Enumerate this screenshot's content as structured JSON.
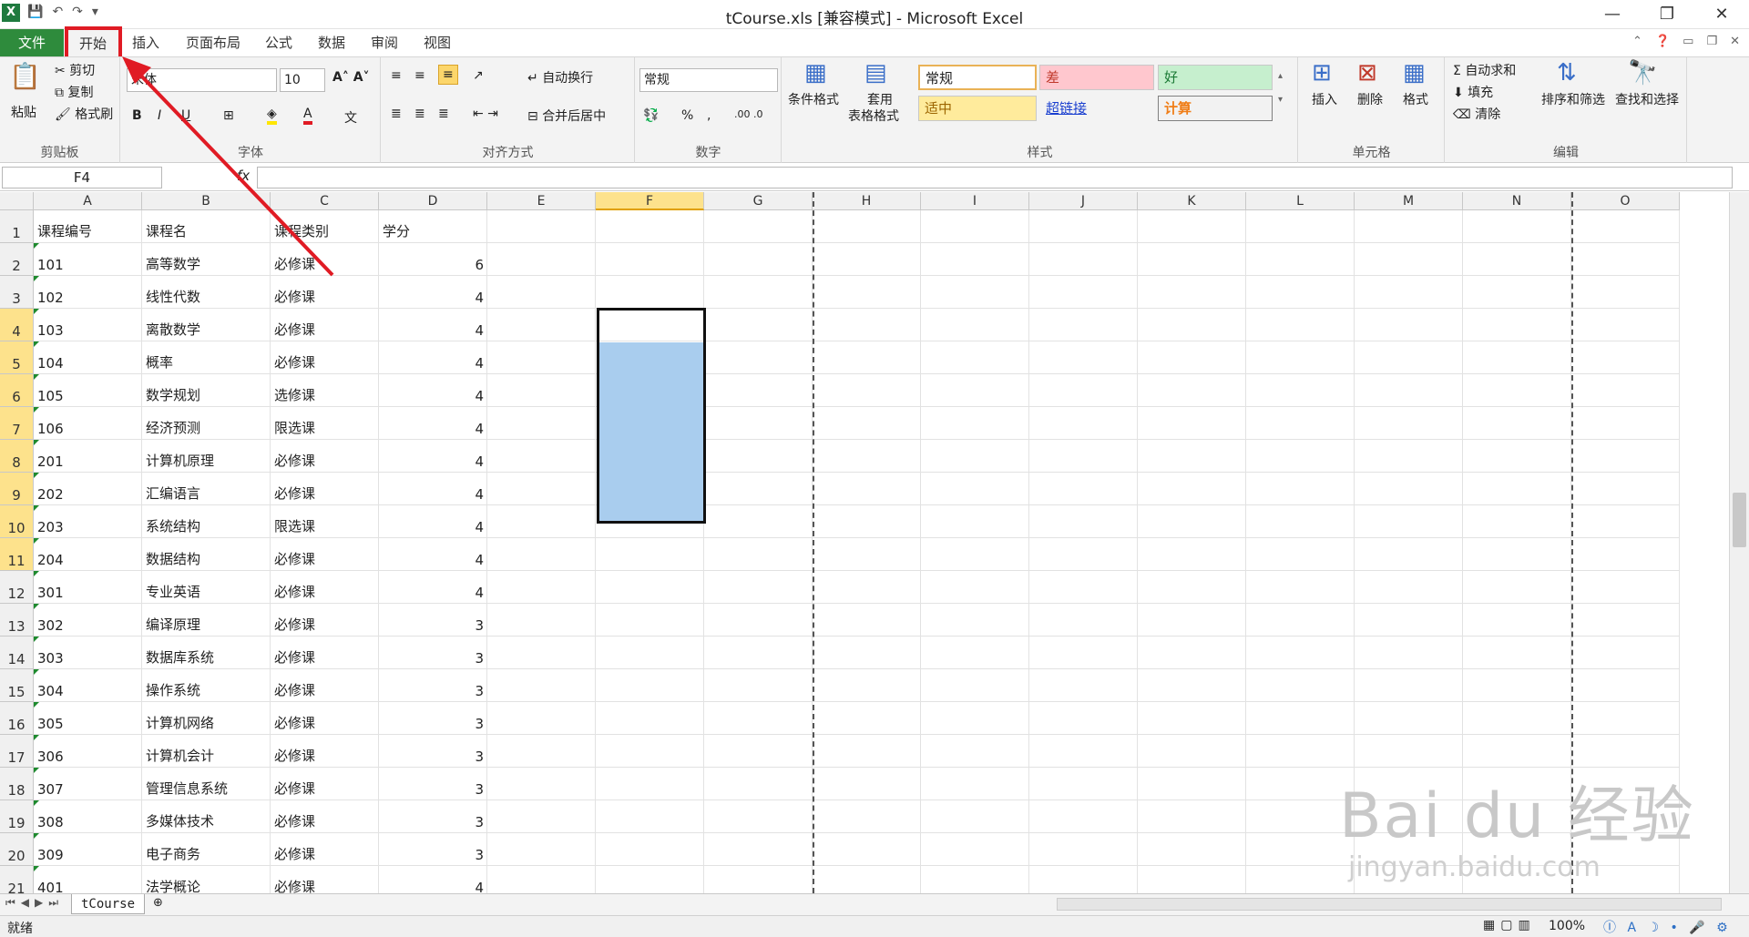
{
  "window": {
    "title": "tCourse.xls  [兼容模式] - Microsoft Excel",
    "min": "—",
    "restore": "❐",
    "close": "✕"
  },
  "tabs": [
    "文件",
    "开始",
    "插入",
    "页面布局",
    "公式",
    "数据",
    "审阅",
    "视图"
  ],
  "ribbon": {
    "clipboard": {
      "paste": "粘贴",
      "cut": "剪切",
      "copy": "复制",
      "format_painter": "格式刷",
      "label": "剪贴板"
    },
    "font": {
      "name": "宋体",
      "size": "10",
      "label": "字体"
    },
    "align": {
      "wrap": "自动换行",
      "merge": "合并后居中",
      "label": "对齐方式"
    },
    "number": {
      "format": "常规",
      "label": "数字"
    },
    "styles": {
      "cond": "条件格式",
      "table1": "套用",
      "table2": "表格格式",
      "normal": "常规",
      "bad": "差",
      "good": "好",
      "neutral": "适中",
      "hyperlink": "超链接",
      "calc": "计算",
      "label": "样式"
    },
    "cells": {
      "insert": "插入",
      "delete": "删除",
      "format": "格式",
      "label": "单元格"
    },
    "editing": {
      "autosum": "自动求和",
      "fill": "填充",
      "clear": "清除",
      "sort": "排序和筛选",
      "find": "查找和选择",
      "label": "编辑"
    }
  },
  "formula_bar": {
    "name_box": "F4",
    "fx": "fx",
    "value": ""
  },
  "columns": [
    "A",
    "B",
    "C",
    "D",
    "E",
    "F",
    "G",
    "H",
    "I",
    "J",
    "K",
    "L",
    "M",
    "N",
    "O"
  ],
  "rows": [
    {
      "n": "1",
      "a": "课程编号",
      "b": "课程名",
      "c": "课程类别",
      "d": "学分"
    },
    {
      "n": "2",
      "a": "101",
      "b": "高等数学",
      "c": "必修课",
      "d": "6"
    },
    {
      "n": "3",
      "a": "102",
      "b": "线性代数",
      "c": "必修课",
      "d": "4"
    },
    {
      "n": "4",
      "a": "103",
      "b": "离散数学",
      "c": "必修课",
      "d": "4"
    },
    {
      "n": "5",
      "a": "104",
      "b": "概率",
      "c": "必修课",
      "d": "4"
    },
    {
      "n": "6",
      "a": "105",
      "b": "数学规划",
      "c": "选修课",
      "d": "4"
    },
    {
      "n": "7",
      "a": "106",
      "b": "经济预测",
      "c": "限选课",
      "d": "4"
    },
    {
      "n": "8",
      "a": "201",
      "b": "计算机原理",
      "c": "必修课",
      "d": "4"
    },
    {
      "n": "9",
      "a": "202",
      "b": "汇编语言",
      "c": "必修课",
      "d": "4"
    },
    {
      "n": "10",
      "a": "203",
      "b": "系统结构",
      "c": "限选课",
      "d": "4"
    },
    {
      "n": "11",
      "a": "204",
      "b": "数据结构",
      "c": "必修课",
      "d": "4"
    },
    {
      "n": "12",
      "a": "301",
      "b": "专业英语",
      "c": "必修课",
      "d": "4"
    },
    {
      "n": "13",
      "a": "302",
      "b": "编译原理",
      "c": "必修课",
      "d": "3"
    },
    {
      "n": "14",
      "a": "303",
      "b": "数据库系统",
      "c": "必修课",
      "d": "3"
    },
    {
      "n": "15",
      "a": "304",
      "b": "操作系统",
      "c": "必修课",
      "d": "3"
    },
    {
      "n": "16",
      "a": "305",
      "b": "计算机网络",
      "c": "必修课",
      "d": "3"
    },
    {
      "n": "17",
      "a": "306",
      "b": "计算机会计",
      "c": "必修课",
      "d": "3"
    },
    {
      "n": "18",
      "a": "307",
      "b": "管理信息系统",
      "c": "必修课",
      "d": "3"
    },
    {
      "n": "19",
      "a": "308",
      "b": "多媒体技术",
      "c": "必修课",
      "d": "3"
    },
    {
      "n": "20",
      "a": "309",
      "b": "电子商务",
      "c": "必修课",
      "d": "3"
    },
    {
      "n": "21",
      "a": "401",
      "b": "法学概论",
      "c": "必修课",
      "d": "4"
    }
  ],
  "sheet_tab": "tCourse",
  "status": {
    "ready": "就绪",
    "zoom": "100%"
  },
  "watermark": {
    "brand": "Bai du 经验",
    "url": "jingyan.baidu.com"
  },
  "colors": {
    "file_tab": "#2e8b3c",
    "highlight": "#e01b24",
    "selection": "#a9cdee"
  }
}
